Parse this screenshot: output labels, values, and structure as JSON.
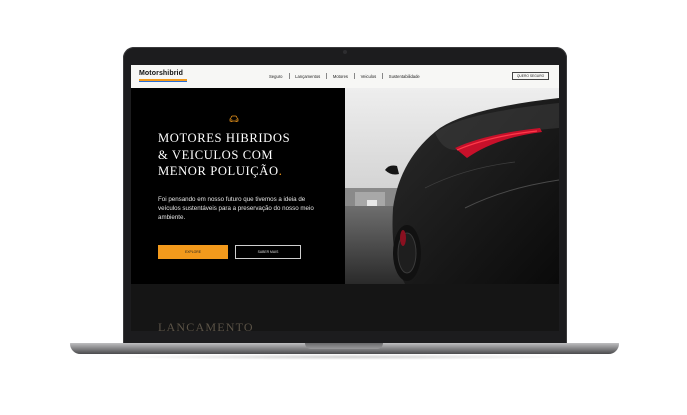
{
  "site": {
    "logo": "Motorshibrid",
    "nav": {
      "links": [
        "Seguro",
        "Lançamentos",
        "Motores",
        "Veiculos",
        "Sustentabilidade"
      ],
      "cta": "QUERO SEGURO"
    },
    "hero": {
      "title_line1": "MOTORES HIBRIDOS",
      "title_line2": "& VEICULOS COM",
      "title_line3": "MENOR POLUIÇÃO",
      "title_dot": ".",
      "text": "Foi pensando em nosso futuro que tivemos a ideia de veículos sustentáveis para a preservação do nosso meio ambiente.",
      "primary_button": "EXPLORE",
      "secondary_button": "SABER MAIS"
    },
    "section": {
      "title": "LANCAMENTO"
    }
  },
  "icons": {
    "car": "car-icon",
    "camera": "camera-icon"
  },
  "colors": {
    "accent": "#f39a1c",
    "logo_underline_blue": "#2b6fd6",
    "hero_bg": "#000000",
    "nav_bg": "#f7f7f5",
    "laptop_frame": "#1c1c1e"
  }
}
